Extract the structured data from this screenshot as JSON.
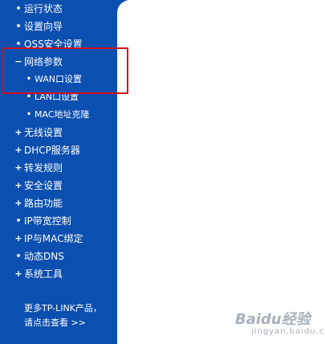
{
  "sidebar": {
    "items": [
      {
        "icon": "bullet-icon",
        "symbol": "•",
        "label": "运行状态"
      },
      {
        "icon": "bullet-icon",
        "symbol": "•",
        "label": "设置向导"
      },
      {
        "icon": "bullet-icon",
        "symbol": "•",
        "label": "QSS安全设置"
      },
      {
        "icon": "collapse-icon",
        "symbol": "−",
        "label": "网络参数"
      },
      {
        "icon": "bullet-icon",
        "symbol": "•",
        "label": "WAN口设置"
      },
      {
        "icon": "bullet-icon",
        "symbol": "•",
        "label": "LAN口设置"
      },
      {
        "icon": "bullet-icon",
        "symbol": "•",
        "label": "MAC地址克隆"
      },
      {
        "icon": "expand-icon",
        "symbol": "+",
        "label": "无线设置"
      },
      {
        "icon": "expand-icon",
        "symbol": "+",
        "label": "DHCP服务器"
      },
      {
        "icon": "expand-icon",
        "symbol": "+",
        "label": "转发规则"
      },
      {
        "icon": "expand-icon",
        "symbol": "+",
        "label": "安全设置"
      },
      {
        "icon": "expand-icon",
        "symbol": "+",
        "label": "路由功能"
      },
      {
        "icon": "bullet-icon",
        "symbol": "•",
        "label": "IP带宽控制"
      },
      {
        "icon": "expand-icon",
        "symbol": "+",
        "label": "IP与MAC绑定"
      },
      {
        "icon": "bullet-icon",
        "symbol": "•",
        "label": "动态DNS"
      },
      {
        "icon": "expand-icon",
        "symbol": "+",
        "label": "系统工具"
      }
    ],
    "promo": {
      "line1": "更多TP-LINK产品，",
      "line2": "请点击查看 >>"
    }
  },
  "watermark": {
    "main": "Baidu经验",
    "sub": "jingyan.baidu.com"
  },
  "colors": {
    "sidebar_bg": "#0b4fb0",
    "text": "#ffffff",
    "highlight": "#d3101b"
  }
}
